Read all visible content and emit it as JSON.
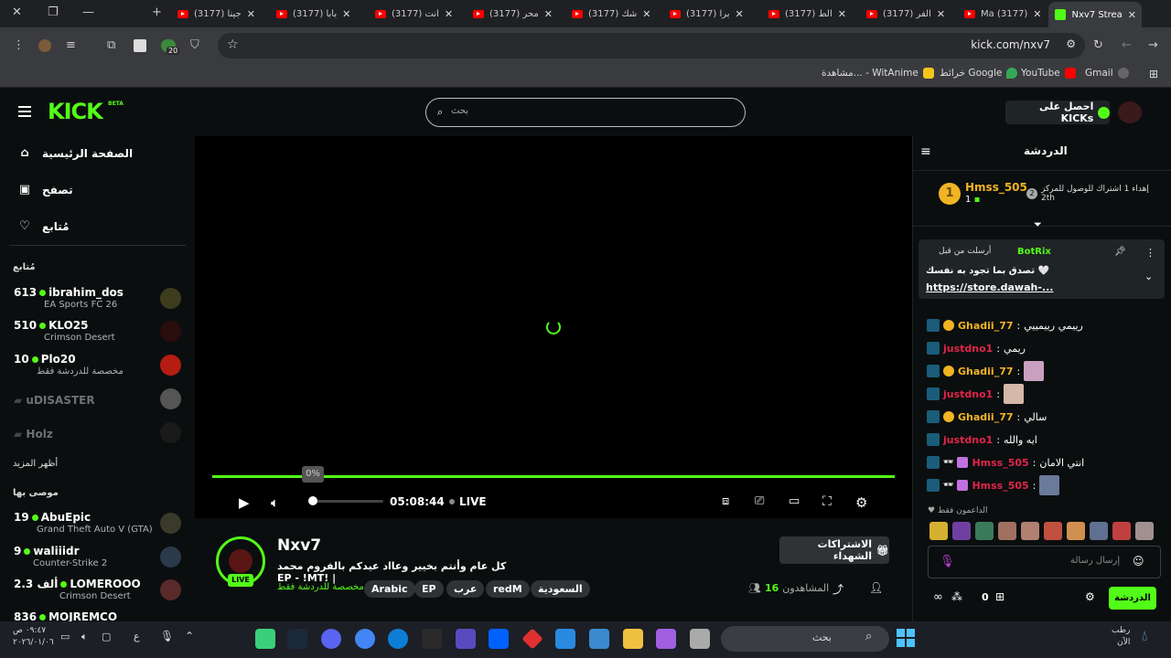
{
  "browser": {
    "tabs": [
      {
        "title": "جينا (3177)"
      },
      {
        "title": "بابا (3177)"
      },
      {
        "title": "انت (3177)"
      },
      {
        "title": "محر (3177)"
      },
      {
        "title": "شك (3177)"
      },
      {
        "title": "برا (3177)"
      },
      {
        "title": "الط (3177)"
      },
      {
        "title": "الفر (3177)"
      },
      {
        "title": "(3177) Ma"
      }
    ],
    "active_tab": "Nxv7 Strea",
    "url": "kick.com/nxv7",
    "extension_badge": "20",
    "bookmarks": [
      {
        "label": "Gmail",
        "color": "#ffffff"
      },
      {
        "label": "YouTube",
        "color": "#ff0000"
      },
      {
        "label": "خرائط Google",
        "color": "#34a853"
      },
      {
        "label": "مشاهدة... - WitAnime",
        "color": "#f5c518"
      }
    ]
  },
  "kick": {
    "logo": "KICK",
    "beta": "BETA",
    "search_placeholder": "بحث",
    "get_kicks": "احصل على KICKs",
    "nav": [
      {
        "label": "الصفحة الرئيسية",
        "icon": "home-icon"
      },
      {
        "label": "تصفح",
        "icon": "browse-icon"
      },
      {
        "label": "مُتابع",
        "icon": "heart-icon"
      }
    ],
    "following_header": "مُتابع",
    "following": [
      {
        "count": "613",
        "name": "ibrahim_dos",
        "category": "EA Sports FC 26",
        "color": "#3d3d1e"
      },
      {
        "count": "510",
        "name": "KLO25",
        "category": "Crimson Desert",
        "color": "#2a0d0d"
      },
      {
        "count": "10",
        "name": "Plo20",
        "category": "مخصصة للدردشة فقط",
        "color": "#b51d12"
      }
    ],
    "offline": [
      {
        "name": "uDISASTER",
        "color": "#555"
      },
      {
        "name": "Holz",
        "color": "#1a1a1a"
      }
    ],
    "show_more": "أظهر المزيد",
    "recommended_header": "موصى بها",
    "recommended": [
      {
        "count": "19",
        "name": "AbuEpic",
        "category": "Grand Theft Auto V (GTA)",
        "color": "#3a3a2a"
      },
      {
        "count": "9",
        "name": "waliiidr",
        "category": "Counter-Strike 2",
        "color": "#2a3a4a"
      },
      {
        "count": "2.3 ألف",
        "name": "LOMEROOO",
        "category": "Crimson Desert",
        "color": "#5a2a2a"
      },
      {
        "count": "836",
        "name": "MOJREMCO",
        "category": "",
        "color": "#333"
      }
    ]
  },
  "player": {
    "progress_pct": "0%",
    "time": "05:08:44",
    "live": "LIVE"
  },
  "stream": {
    "channel": "Nxv7",
    "live_badge": "LIVE",
    "title": "كل عام وأنتم بخيير وعااد عيدكم بالفروم محمد | !EP - !MT",
    "sub_only": "مخصصة للدردشة فقط",
    "tags": [
      "السعودية",
      "redM",
      "عرب",
      "EP",
      "Arabic"
    ],
    "gift_subs": "الاشتراكات الشهداء",
    "viewers_label": "المشاهدون",
    "viewers_count": "16"
  },
  "chat": {
    "title": "الدردشة",
    "top_gifter": {
      "rank": "1",
      "user": "Hmss_505",
      "count": "1"
    },
    "gift_message": "إهداء 1 اشتراك للوصول للمركز",
    "gift_rank": "2",
    "gift_place": "2th",
    "pinned": {
      "user": "BotRix",
      "by": "أرسلت من قبل",
      "text": "تصدق بما تجود به نفسك 🤍",
      "link": "https://store.dawah-..."
    },
    "messages": [
      {
        "user": "Ghadii_77",
        "color": "#f0b424",
        "coin": true,
        "text": "رييمي رييمييي",
        "emote": false
      },
      {
        "user": "justdno1",
        "color": "#e0254b",
        "coin": false,
        "text": "ريمي",
        "emote": false
      },
      {
        "user": "Ghadii_77",
        "color": "#f0b424",
        "coin": true,
        "text": "",
        "emote": true,
        "emote_color": "#c9a0c0"
      },
      {
        "user": "justdno1",
        "color": "#e0254b",
        "coin": false,
        "text": "",
        "emote": true,
        "emote_color": "#d4b8a8"
      },
      {
        "user": "Ghadii_77",
        "color": "#f0b424",
        "coin": true,
        "text": "سالي",
        "emote": false
      },
      {
        "user": "justdno1",
        "color": "#e0254b",
        "coin": false,
        "text": "ايه والله",
        "emote": false
      },
      {
        "user": "Hmss_505",
        "color": "#e0254b",
        "coin": false,
        "text": "انتي الامان",
        "emote": false
      },
      {
        "user": "Hmss_505",
        "color": "#e0254b",
        "coin": false,
        "text": "",
        "emote": true,
        "emote_color": "#6a7a9a"
      }
    ],
    "supporters_label": "الداعمون فقط",
    "input_placeholder": "إرسال رسالة",
    "kicks_count": "0",
    "send": "الدردشة"
  },
  "taskbar": {
    "search_placeholder": "بحث",
    "time": "٠٩:٤٧ ص",
    "date": "٢٠٢٦/٠١/٠٦",
    "weather": "رطب",
    "weather_sub": "الآن"
  }
}
